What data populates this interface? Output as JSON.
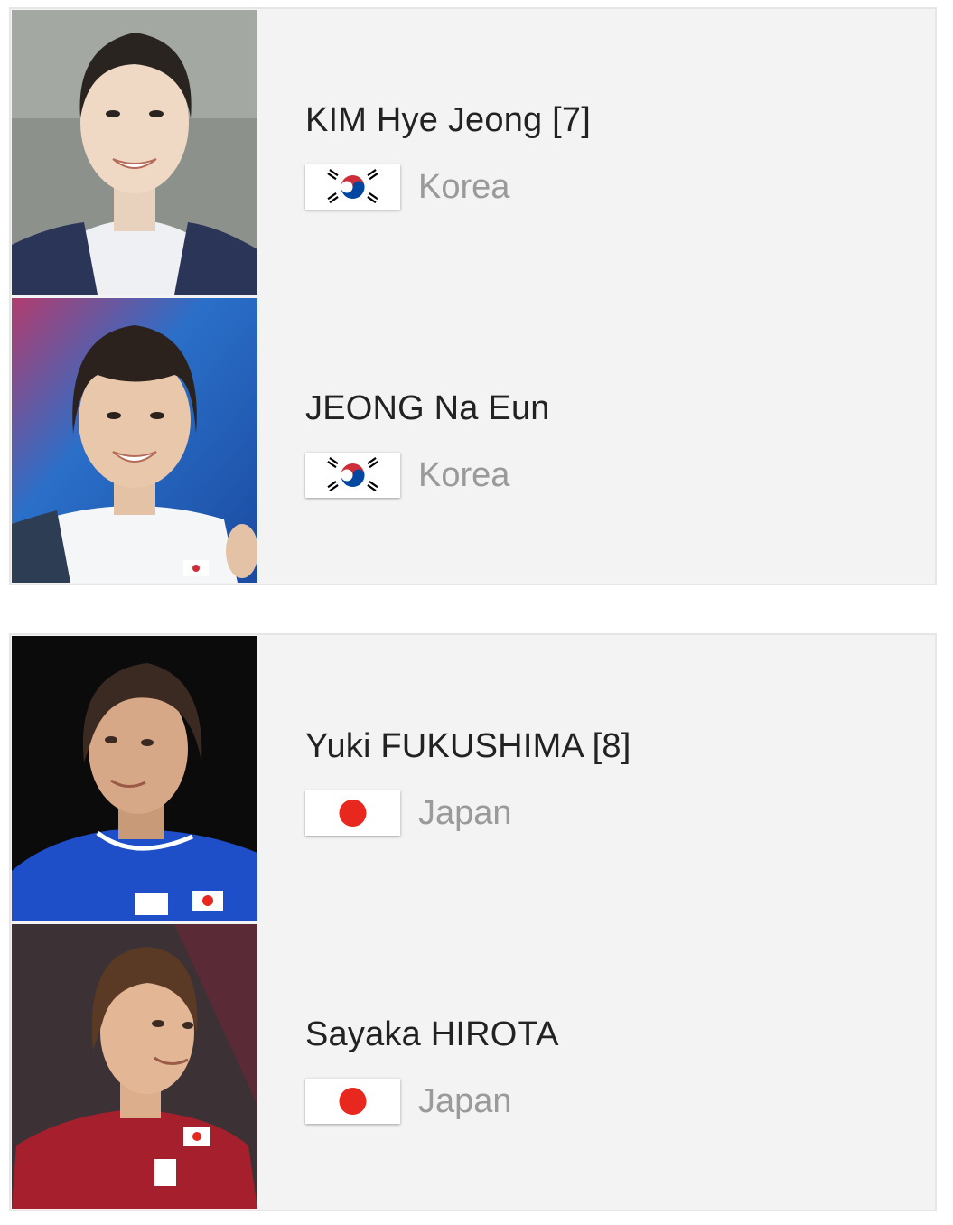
{
  "colors": {
    "card_background": "#f3f3f3",
    "name_text": "#222222",
    "country_text": "#9a9a9a",
    "korea_red": "#cd2e3a",
    "korea_blue": "#0047a0",
    "japan_red": "#e8281e"
  },
  "pairs": [
    {
      "players": [
        {
          "name": "KIM Hye Jeong [7]",
          "country": "Korea",
          "flag": "korea-flag",
          "photo": "player-photo"
        },
        {
          "name": "JEONG Na Eun",
          "country": "Korea",
          "flag": "korea-flag",
          "photo": "player-photo"
        }
      ]
    },
    {
      "players": [
        {
          "name": "Yuki FUKUSHIMA [8]",
          "country": "Japan",
          "flag": "japan-flag",
          "photo": "player-photo"
        },
        {
          "name": "Sayaka HIROTA",
          "country": "Japan",
          "flag": "japan-flag",
          "photo": "player-photo"
        }
      ]
    }
  ]
}
